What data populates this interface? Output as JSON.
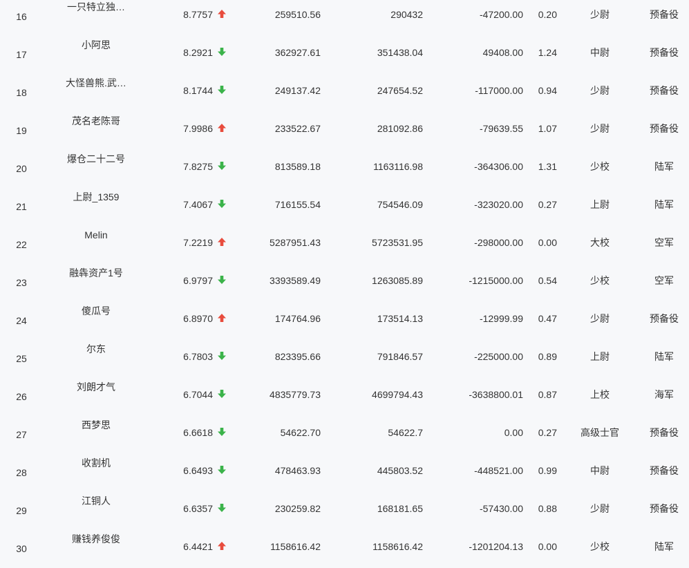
{
  "colors": {
    "up": "#e84c3d",
    "down": "#3bb34a",
    "text": "#333333",
    "background": "#f7f8fa"
  },
  "rows": [
    {
      "rank": "16",
      "name": "一只特立独…",
      "score": "8.7757",
      "trend": "up",
      "v1": "259510.56",
      "v2": "290432",
      "v3": "-47200.00",
      "v4": "0.20",
      "military_rank": "少尉",
      "branch": "预备役"
    },
    {
      "rank": "17",
      "name": "小阿思",
      "score": "8.2921",
      "trend": "down",
      "v1": "362927.61",
      "v2": "351438.04",
      "v3": "49408.00",
      "v4": "1.24",
      "military_rank": "中尉",
      "branch": "预备役"
    },
    {
      "rank": "18",
      "name": "大怪兽熊.武…",
      "score": "8.1744",
      "trend": "down",
      "v1": "249137.42",
      "v2": "247654.52",
      "v3": "-117000.00",
      "v4": "0.94",
      "military_rank": "少尉",
      "branch": "预备役"
    },
    {
      "rank": "19",
      "name": "茂名老陈哥",
      "score": "7.9986",
      "trend": "up",
      "v1": "233522.67",
      "v2": "281092.86",
      "v3": "-79639.55",
      "v4": "1.07",
      "military_rank": "少尉",
      "branch": "预备役"
    },
    {
      "rank": "20",
      "name": "爆仓二十二号",
      "score": "7.8275",
      "trend": "down",
      "v1": "813589.18",
      "v2": "1163116.98",
      "v3": "-364306.00",
      "v4": "1.31",
      "military_rank": "少校",
      "branch": "陆军"
    },
    {
      "rank": "21",
      "name": "上尉_1359",
      "score": "7.4067",
      "trend": "down",
      "v1": "716155.54",
      "v2": "754546.09",
      "v3": "-323020.00",
      "v4": "0.27",
      "military_rank": "上尉",
      "branch": "陆军"
    },
    {
      "rank": "22",
      "name": "Melin",
      "score": "7.2219",
      "trend": "up",
      "v1": "5287951.43",
      "v2": "5723531.95",
      "v3": "-298000.00",
      "v4": "0.00",
      "military_rank": "大校",
      "branch": "空军"
    },
    {
      "rank": "23",
      "name": "融犇资产1号",
      "score": "6.9797",
      "trend": "down",
      "v1": "3393589.49",
      "v2": "1263085.89",
      "v3": "-1215000.00",
      "v4": "0.54",
      "military_rank": "少校",
      "branch": "空军"
    },
    {
      "rank": "24",
      "name": "傻瓜号",
      "score": "6.8970",
      "trend": "up",
      "v1": "174764.96",
      "v2": "173514.13",
      "v3": "-12999.99",
      "v4": "0.47",
      "military_rank": "少尉",
      "branch": "预备役"
    },
    {
      "rank": "25",
      "name": "尔东",
      "score": "6.7803",
      "trend": "down",
      "v1": "823395.66",
      "v2": "791846.57",
      "v3": "-225000.00",
      "v4": "0.89",
      "military_rank": "上尉",
      "branch": "陆军"
    },
    {
      "rank": "26",
      "name": "刘朗才气",
      "score": "6.7044",
      "trend": "down",
      "v1": "4835779.73",
      "v2": "4699794.43",
      "v3": "-3638800.01",
      "v4": "0.87",
      "military_rank": "上校",
      "branch": "海军"
    },
    {
      "rank": "27",
      "name": "西梦思",
      "score": "6.6618",
      "trend": "down",
      "v1": "54622.70",
      "v2": "54622.7",
      "v3": "0.00",
      "v4": "0.27",
      "military_rank": "高级士官",
      "branch": "预备役"
    },
    {
      "rank": "28",
      "name": "收割机",
      "score": "6.6493",
      "trend": "down",
      "v1": "478463.93",
      "v2": "445803.52",
      "v3": "-448521.00",
      "v4": "0.99",
      "military_rank": "中尉",
      "branch": "预备役"
    },
    {
      "rank": "29",
      "name": "江铜人",
      "score": "6.6357",
      "trend": "down",
      "v1": "230259.82",
      "v2": "168181.65",
      "v3": "-57430.00",
      "v4": "0.88",
      "military_rank": "少尉",
      "branch": "预备役"
    },
    {
      "rank": "30",
      "name": "赚钱养俊俊",
      "score": "6.4421",
      "trend": "up",
      "v1": "1158616.42",
      "v2": "1158616.42",
      "v3": "-1201204.13",
      "v4": "0.00",
      "military_rank": "少校",
      "branch": "陆军"
    }
  ]
}
